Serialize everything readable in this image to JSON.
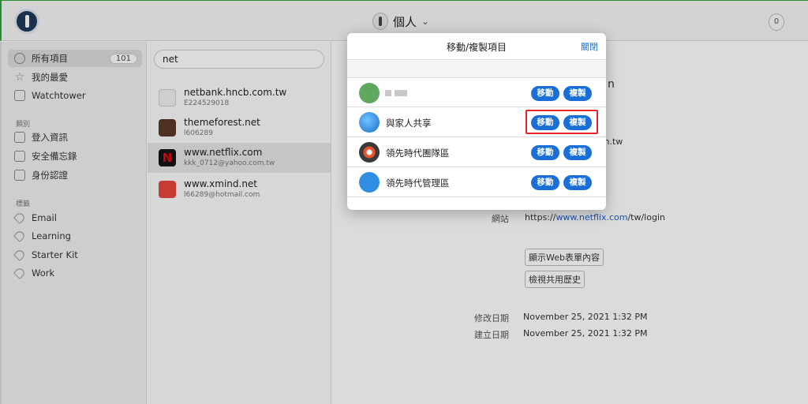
{
  "vault": {
    "name": "個人",
    "chevron": "chevron-down-icon"
  },
  "notifications": {
    "count": "0"
  },
  "sidebar": {
    "items": [
      {
        "label": "所有項目",
        "badge": "101",
        "icon": "grid-icon",
        "active": true
      },
      {
        "label": "我的最愛",
        "icon": "star-icon"
      },
      {
        "label": "Watchtower",
        "icon": "tower-icon"
      }
    ],
    "categories_header": "類別",
    "categories": [
      {
        "label": "登入資訊",
        "icon": "login-icon"
      },
      {
        "label": "安全備忘錄",
        "icon": "note-icon"
      },
      {
        "label": "身份認證",
        "icon": "id-card-icon"
      }
    ],
    "tags_header": "標籤",
    "tags": [
      {
        "label": "Email"
      },
      {
        "label": "Learning"
      },
      {
        "label": "Starter Kit"
      },
      {
        "label": "Work"
      }
    ]
  },
  "search": {
    "value": "net"
  },
  "list": [
    {
      "title": "netbank.hncb.com.tw",
      "subtitle": "E224529018",
      "color": "#f0f0f0"
    },
    {
      "title": "themeforest.net",
      "subtitle": "l606289",
      "color": "#5b3a2a"
    },
    {
      "title": "www.netflix.com",
      "subtitle": "kkk_0712@yahoo.com.tw",
      "color": "#141414",
      "selected": true
    },
    {
      "title": "www.xmind.net",
      "subtitle": "l66289@hotmail.com",
      "color": "#e8453c"
    }
  ],
  "detail": {
    "title_fragment": "n",
    "username_fragment": "om.tw",
    "website_label": "網站",
    "website_prefix": "https://",
    "website_link": "www.netflix.com",
    "website_suffix": "/tw/login",
    "show_form_button": "顯示Web表單內容",
    "share_history_button": "檢視共用歷史",
    "modified_label": "修改日期",
    "modified_value": "November 25, 2021 1:32 PM",
    "created_label": "建立日期",
    "created_value": "November 25, 2021 1:32 PM"
  },
  "modal": {
    "title": "移動/複製項目",
    "close_label": "關閉",
    "move_label": "移動",
    "copy_label": "複製",
    "vaults": [
      {
        "name": "",
        "icon": "personal-avatar-icon",
        "redacted": true
      },
      {
        "name": "與家人共享",
        "icon": "globe-icon",
        "highlighted": true
      },
      {
        "name": "領先時代團隊區",
        "icon": "target-icon"
      },
      {
        "name": "領先時代管理區",
        "icon": "tools-icon"
      }
    ]
  },
  "colors": {
    "accent": "#1a6fd6",
    "highlight": "#e5252d"
  }
}
